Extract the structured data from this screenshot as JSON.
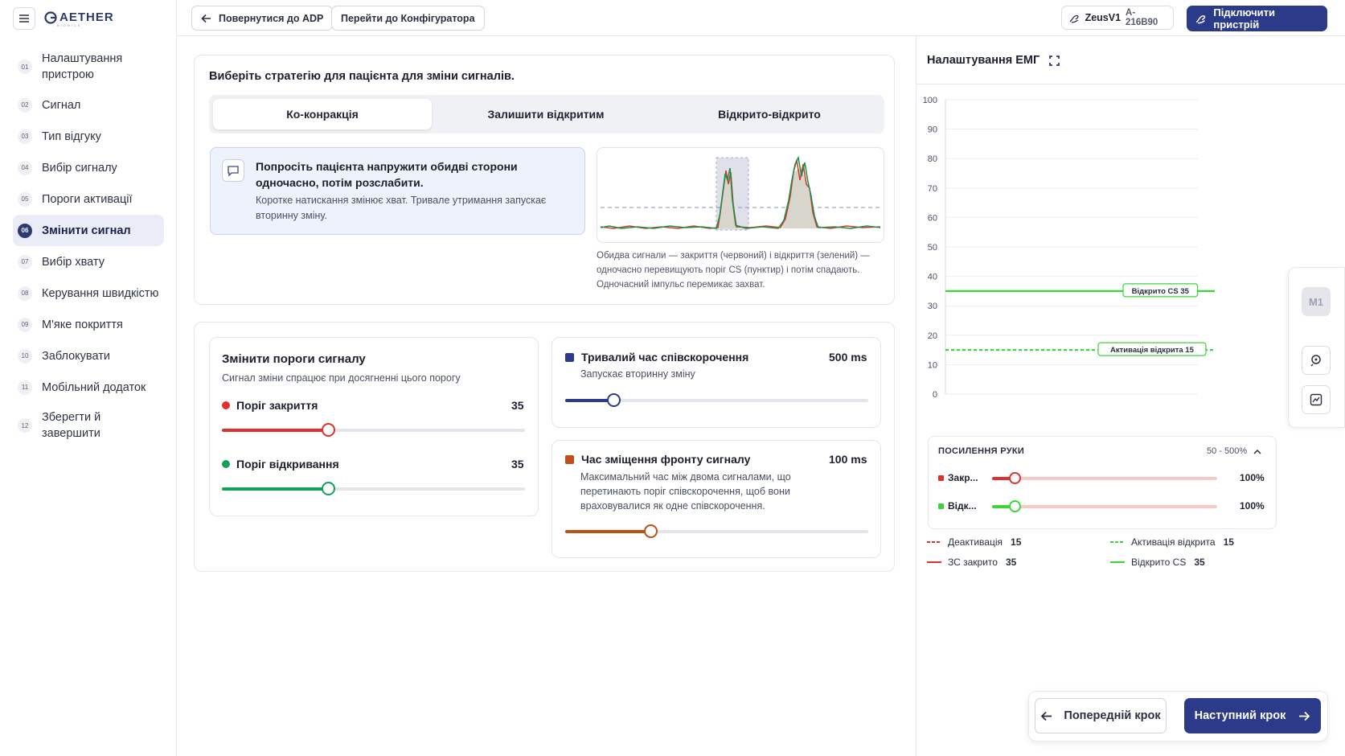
{
  "app": {
    "logo_text": "AETHER",
    "logo_sub": "BIONICS"
  },
  "header": {
    "back_adp": "Повернутися до ADP",
    "to_configurator": "Перейти до Конфігуратора",
    "device_name": "ZeusV1",
    "device_id": "A-216B90",
    "connect": "Підключити пристрій"
  },
  "sidebar": {
    "items": [
      {
        "num": "01",
        "label": "Налаштування пристрою"
      },
      {
        "num": "02",
        "label": "Сигнал"
      },
      {
        "num": "03",
        "label": "Тип відгуку"
      },
      {
        "num": "04",
        "label": "Вибір сигналу"
      },
      {
        "num": "05",
        "label": "Пороги активації"
      },
      {
        "num": "06",
        "label": "Змінити сигнал",
        "active": true
      },
      {
        "num": "07",
        "label": "Вибір хвату"
      },
      {
        "num": "08",
        "label": "Керування швидкістю"
      },
      {
        "num": "09",
        "label": "М'яке покриття"
      },
      {
        "num": "10",
        "label": "Заблокувати"
      },
      {
        "num": "11",
        "label": "Мобільний додаток"
      },
      {
        "num": "12",
        "label": "Зберегти й завершити"
      }
    ]
  },
  "strategy": {
    "title": "Виберіть стратегію для пацієнта для зміни сигналів.",
    "tabs": [
      "Ко-конракція",
      "Залишити відкритим",
      "Відкрито-відкрито"
    ],
    "active_tab": 0,
    "info_title": "Попросіть пацієнта напружити обидві сторони одночасно, потім розслабити.",
    "info_text": "Коротке натискання змінює хват. Тривале утримання запускає вторинну зміну.",
    "caption": "Обидва сигнали — закриття (червоний) і відкриття (зелений) — одночасно перевищують поріг CS (пунктир) і потім спадають. Одночасний імпульс перемикає захват."
  },
  "thresholds": {
    "title": "Змінити пороги сигналу",
    "subtitle": "Сигнал зміни спрацює при досягненні цього порогу",
    "close_label": "Поріг закриття",
    "close_value": "35",
    "close_level": 0.35,
    "open_label": "Поріг відкривання",
    "open_value": "35",
    "open_level": 0.35
  },
  "cocontraction": {
    "title": "Тривалий час співскорочення",
    "subtitle": "Запускає вторинну зміну",
    "value": "500 ms",
    "level": 0.16
  },
  "frontshift": {
    "title": "Час зміщення фронту сигналу",
    "subtitle": "Максимальний час між двома сигналами, що перетинають поріг співскорочення, щоб вони враховувалися як одне співскорочення.",
    "value": "100 ms",
    "level": 0.28
  },
  "emg": {
    "title": "Налаштування ЕМГ",
    "y_ticks": [
      "100",
      "90",
      "80",
      "70",
      "60",
      "50",
      "40",
      "30",
      "20",
      "10",
      "0"
    ],
    "open_cs_label": "Відкрито CS 35",
    "open_cs_value": 35,
    "activation_open_label": "Активація відкрита 15",
    "activation_open_value": 15,
    "tool_m1": "M1"
  },
  "gain": {
    "title": "ПОСИЛЕННЯ РУКИ",
    "range": "50 - 500%",
    "close_label": "Закр...",
    "close_value": "100%",
    "close_level": 0.1,
    "open_label": "Відк...",
    "open_value": "100%",
    "open_level": 0.1
  },
  "legend": {
    "deactivation": "Деактивація",
    "deactivation_val": "15",
    "activation_open": "Активація відкрита",
    "activation_open_val": "15",
    "cs_closed": "ЗС закрито",
    "cs_closed_val": "35",
    "open_cs": "Відкрито CS",
    "open_cs_val": "35"
  },
  "footer": {
    "prev": "Попередній крок",
    "next": "Наступний крок"
  },
  "colors": {
    "primary": "#2c3a8a",
    "close": "#e0302e",
    "open": "#14a05a",
    "emg_green": "#3bd43b",
    "brown": "#c0501a"
  }
}
